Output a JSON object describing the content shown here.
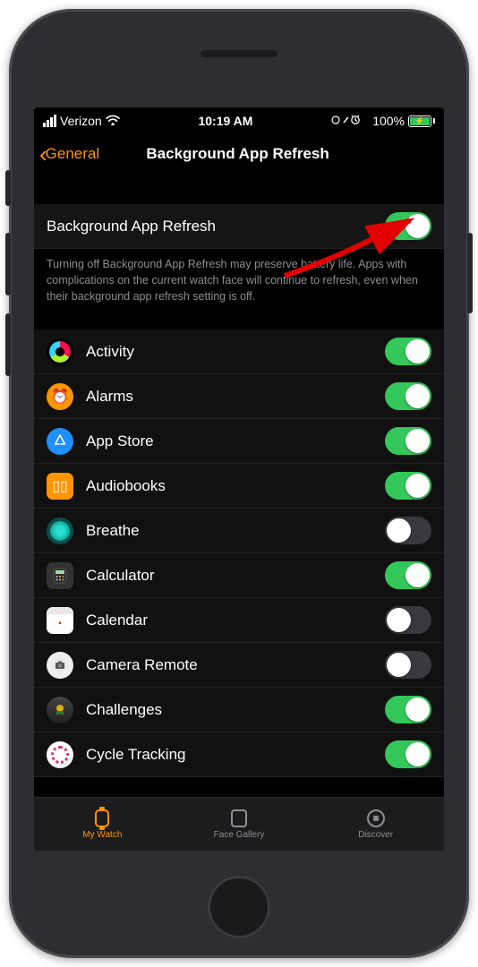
{
  "status": {
    "carrier": "Verizon",
    "time": "10:19 AM",
    "battery_pct": "100%",
    "indicators": "⟳ ↗ ⏰"
  },
  "nav": {
    "back_label": "General",
    "title": "Background App Refresh"
  },
  "master": {
    "label": "Background App Refresh",
    "on": true,
    "footer": "Turning off Background App Refresh may preserve battery life. Apps with complications on the current watch face will continue to refresh, even when their background app refresh setting is off."
  },
  "apps": [
    {
      "name": "Activity",
      "on": true,
      "icon": "activity"
    },
    {
      "name": "Alarms",
      "on": true,
      "icon": "alarms"
    },
    {
      "name": "App Store",
      "on": true,
      "icon": "appstore"
    },
    {
      "name": "Audiobooks",
      "on": true,
      "icon": "audiobooks"
    },
    {
      "name": "Breathe",
      "on": false,
      "icon": "breathe"
    },
    {
      "name": "Calculator",
      "on": true,
      "icon": "calculator"
    },
    {
      "name": "Calendar",
      "on": false,
      "icon": "calendar"
    },
    {
      "name": "Camera Remote",
      "on": false,
      "icon": "camera"
    },
    {
      "name": "Challenges",
      "on": true,
      "icon": "challenges"
    },
    {
      "name": "Cycle Tracking",
      "on": true,
      "icon": "cycle"
    }
  ],
  "tabs": [
    {
      "label": "My Watch",
      "icon": "watch",
      "active": true
    },
    {
      "label": "Face Gallery",
      "icon": "face",
      "active": false
    },
    {
      "label": "Discover",
      "icon": "compass",
      "active": false
    }
  ]
}
